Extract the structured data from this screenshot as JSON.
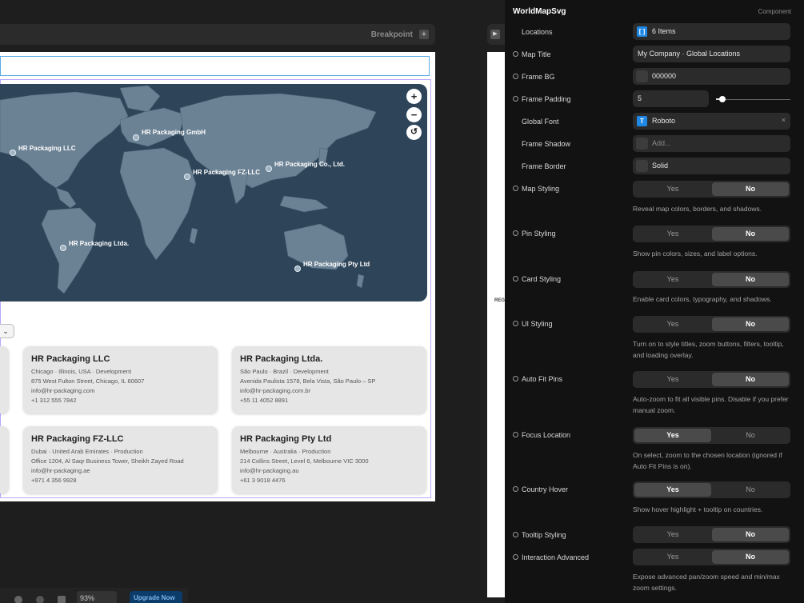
{
  "breakpoint": {
    "label": "Breakpoint",
    "add": "+"
  },
  "map": {
    "zoom_in": "+",
    "zoom_out": "−",
    "reset": "↺",
    "pins": [
      {
        "label": "HR Packaging LLC"
      },
      {
        "label": "HR Packaging GmbH"
      },
      {
        "label": "HR Packaging FZ-LLC"
      },
      {
        "label": "HR Packaging Co., Ltd."
      },
      {
        "label": "HR Packaging Ltda."
      },
      {
        "label": "HR Packaging Pty Ltd"
      }
    ]
  },
  "filter": {
    "chevron": "⌄"
  },
  "cards": [
    {
      "title": "HR Packaging LLC",
      "meta": "Chicago · Illinois, USA · Development",
      "address": "875 West Fulton Street, Chicago, IL 60607",
      "email": "info@hr-packaging.com",
      "phone": "+1 312 555 7842"
    },
    {
      "title": "HR Packaging Ltda.",
      "meta": "São Paulo · Brazil · Development",
      "address": "Avenida Paulista 1578, Bela Vista, São Paulo – SP",
      "email": "info@hr-packaging.com.br",
      "phone": "+55 11 4052 8891"
    },
    {
      "title": "HR Packaging FZ-LLC",
      "meta": "Dubai · United Arab Emirates · Production",
      "address": "Office 1204, Al Saqr Business Tower, Sheikh Zayed Road",
      "email": "info@hr-packaging.ae",
      "phone": "+971 4 356 9928"
    },
    {
      "title": "HR Packaging Pty Ltd",
      "meta": "Melbourne · Australia · Production",
      "address": "214 Collins Street, Level 6, Melbourne VIC 3000",
      "email": "info@hr-packaging.au",
      "phone": "+61 3 9018 4476"
    }
  ],
  "bottom_bar": {
    "zoom": "93%",
    "upgrade": "Upgrade Now"
  },
  "mid_strip": {
    "text": "REG"
  },
  "panel": {
    "title": "WorldMapSvg",
    "type": "Component",
    "locations": {
      "label": "Locations",
      "badge": "[ ]",
      "value": "6 Items"
    },
    "map_title": {
      "label": "Map Title",
      "value": "My Company · Global Locations"
    },
    "frame_bg": {
      "label": "Frame BG",
      "value": "000000"
    },
    "frame_padding": {
      "label": "Frame Padding",
      "value": "5",
      "slider_level": 0.05
    },
    "global_font": {
      "label": "Global Font",
      "badge": "T",
      "value": "Roboto",
      "clear": "×"
    },
    "frame_shadow": {
      "label": "Frame Shadow",
      "placeholder": "Add..."
    },
    "frame_border": {
      "label": "Frame Border",
      "value": "Solid"
    },
    "toggles": [
      {
        "label": "Map Styling",
        "yes": "Yes",
        "no": "No",
        "selected": "No",
        "help": "Reveal map colors, borders, and shadows."
      },
      {
        "label": "Pin Styling",
        "yes": "Yes",
        "no": "No",
        "selected": "No",
        "help": "Show pin colors, sizes, and label options."
      },
      {
        "label": "Card Styling",
        "yes": "Yes",
        "no": "No",
        "selected": "No",
        "help": "Enable card colors, typography, and shadows."
      },
      {
        "label": "UI Styling",
        "yes": "Yes",
        "no": "No",
        "selected": "No",
        "help": "Turn on to style titles, zoom buttons, filters, tooltip, and loading overlay."
      },
      {
        "label": "Auto Fit Pins",
        "yes": "Yes",
        "no": "No",
        "selected": "No",
        "help": "Auto-zoom to fit all visible pins. Disable if you prefer manual zoom."
      },
      {
        "label": "Focus Location",
        "yes": "Yes",
        "no": "No",
        "selected": "Yes",
        "help": "On select, zoom to the chosen location (ignored if Auto Fit Pins is on)."
      },
      {
        "label": "Country Hover",
        "yes": "Yes",
        "no": "No",
        "selected": "Yes",
        "help": "Show hover highlight + tooltip on countries."
      },
      {
        "label": "Tooltip Styling",
        "yes": "Yes",
        "no": "No",
        "selected": "No",
        "help": ""
      },
      {
        "label": "Interaction Advanced",
        "yes": "Yes",
        "no": "No",
        "selected": "No",
        "help": "Expose advanced pan/zoom speed and min/max zoom settings."
      }
    ]
  }
}
